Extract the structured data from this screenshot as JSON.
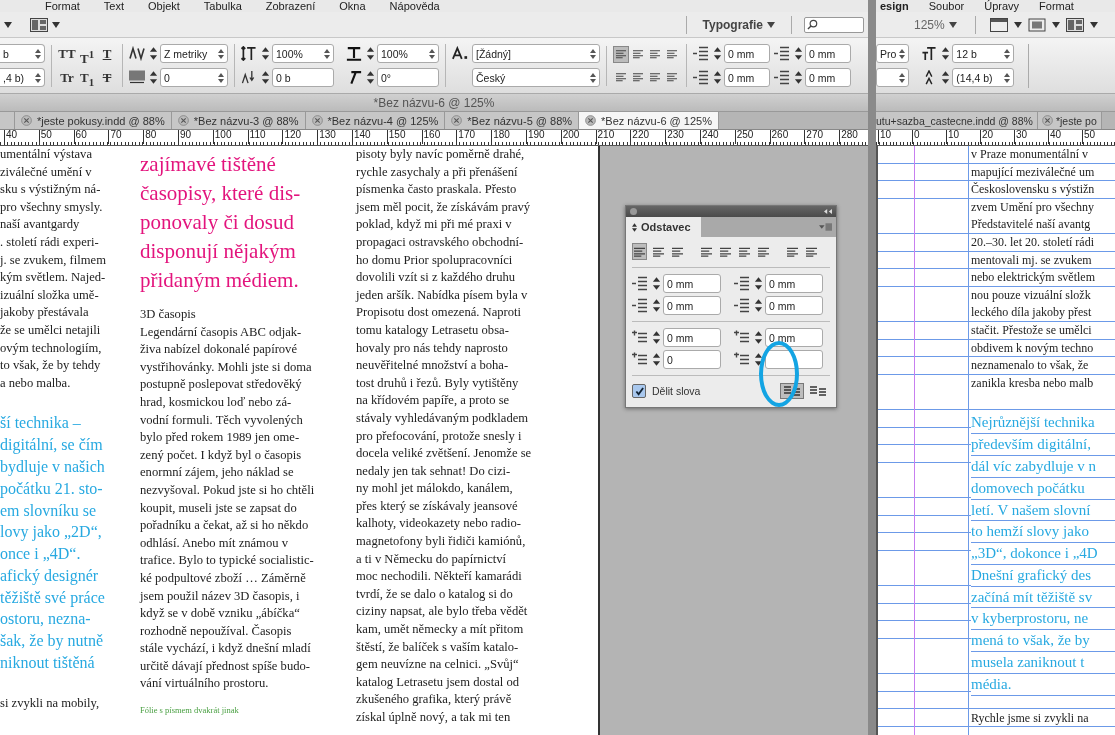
{
  "left_window": {
    "menu": [
      "Format",
      "Text",
      "Objekt",
      "Tabulka",
      "Zobrazení",
      "Okna",
      "Nápověda"
    ],
    "toolbar": {
      "workspace": "Typografie"
    },
    "control_panel": {
      "size_fields": [
        "b",
        ",4 b)"
      ],
      "type_buttons": [
        {
          "label": "TT",
          "kind": "plain"
        },
        {
          "label": "T$^{1}$",
          "kind": "plain"
        },
        {
          "label": "T",
          "kind": "underline"
        },
        {
          "label": "Tr",
          "kind": "plain"
        },
        {
          "label": "T$_{1}$",
          "kind": "plain"
        },
        {
          "label": "T",
          "kind": "strike"
        }
      ],
      "kerning": "Z metriky",
      "tracking": "0",
      "vertical_scale": "100%",
      "baseline_shift": "0 b",
      "horizontal_scale": "100%",
      "skew": "0°",
      "character_style": "[Žádný]",
      "language": "Český",
      "align_buttons": [
        {
          "selected": true
        },
        {
          "selected": false
        },
        {
          "selected": false
        },
        {
          "selected": false
        },
        {
          "selected": false
        },
        {
          "selected": false
        },
        {
          "selected": false
        },
        {
          "selected": false
        }
      ],
      "indents": [
        "0 mm",
        "0 mm",
        "0 mm",
        "0 mm"
      ]
    },
    "document_title": "*Bez názvu-6 @ 125%",
    "tabs": [
      {
        "label": "*jeste pokusy.indd @ 88%",
        "selected": false
      },
      {
        "label": "*Bez názvu-3 @ 88%",
        "selected": false
      },
      {
        "label": "*Bez názvu-4 @ 125%",
        "selected": false
      },
      {
        "label": "*Bez názvu-5 @ 88%",
        "selected": false
      },
      {
        "label": "*Bez názvu-6 @ 125%",
        "selected": true
      }
    ],
    "ruler": [
      "40",
      "50",
      "60",
      "70",
      "80",
      "90",
      "100",
      "110",
      "120",
      "130",
      "140",
      "150",
      "160",
      "170",
      "180",
      "190",
      "200",
      "210",
      "220",
      "230",
      "240",
      "250",
      "260",
      "270",
      "280"
    ],
    "page": {
      "column_1": {
        "body_lines": [
          "umentální výstava",
          "ziválečné umění v",
          "sku s výstižným ná-",
          "pro všechny smysly.",
          "naší avantgardy",
          ". století rádi experi-",
          "j. se zvukem, filmem",
          "kým světlem. Najed-",
          "izuální složka umě-",
          "jakoby přestávala",
          "že se umělci netajili",
          "ovým technologiím,",
          "to však, že by tehdy",
          "a nebo malba."
        ],
        "pull_quote_lines": [
          "ší technika –",
          "digitální, se čím",
          "bydluje v našich",
          "počátku 21. sto-",
          "em slovníku se",
          "lovy jako „2D“,",
          "once i „4D“.",
          "afický designér",
          "těžiště své práce",
          "ostoru, nezna-",
          "šak, že by nutně",
          "niknout tištěná"
        ],
        "tail_lines": [
          "si zvykli na mobily,"
        ]
      },
      "column_2": {
        "heading_lines": [
          "zajímavé tištěné",
          "časopisy, které dis-",
          "ponovaly či dosud",
          "disponují nějakým",
          "přidaným médiem."
        ],
        "subhead": "3D časopis",
        "body_lines": [
          "Legendární časopis ABC odjak-",
          "živa nabízel dokonalé papírové",
          "vystřihovánky. Mohli jste si doma",
          "postupně poslepovat středověký",
          "hrad, kosmickou loď nebo zá-",
          "vodní formuli. Těch vyvolených",
          "bylo před rokem 1989 jen ome-",
          "zený počet. I když byl o časopis",
          "enormní zájem, jeho náklad se",
          "nezvyšoval. Pokud jste si ho chtěli",
          "koupit, museli jste se zapsat do",
          "pořadníku a čekat, až si ho někdo",
          "odhlásí. Anebo mít známou v",
          "trafice. Bylo to typické socialistic-",
          "ké podpultové zboží … Záměrně",
          "jsem použil název 3D časopis, i",
          "když se v době vzniku „ábíčka“",
          "rozhodně nepoužíval. Časopis",
          "stále vychází, i když dnešní mladí",
          "určitě dávají přednost spíše budo-",
          "vání virtuálního prostoru."
        ],
        "caption": "Fólie s písmem dvakrát jinak"
      },
      "column_3": {
        "body_lines": [
          "pisoty byly navíc poměrně drahé,",
          "rychle zasychaly a při přenášení",
          "písmenka často praskala. Přesto",
          "jsem měl pocit, že získávám pravý",
          "poklad, když mi při mé praxi v",
          "propagaci ostravského obchodní-",
          "ho domu Prior spolupracovníci",
          "dovolili vzít si z každého druhu",
          "jeden aršík. Nabídka písem byla v",
          "Propisotu dost omezená. Naproti",
          "tomu katalogy Letrasetu obsa-",
          "hovaly pro nás tehdy naprosto",
          "neuvěřitelné množství a boha-",
          "tost druhů i řezů. Byly vytištěny",
          "na křídovém papíře, a proto se",
          "stávaly vyhledávaným podkladem",
          "pro přefocování, protože snesly i",
          "docela veliké zvětšení. Jenomže se",
          "nedaly jen tak sehnat! Do cizi-",
          "ny mohl jet málokdo, kanálem,",
          "přes který se získávaly jeansové",
          "kalhoty, videokazety nebo radio-",
          "magnetofony byli řidiči kamiónů,",
          "a ti v Německu do papírnictví",
          "moc nechodili. Někteří kamarádi",
          "tvrdí, že se dalo o katalog si do",
          "ciziny napsat, ale bylo třeba vědět",
          "kam, umět německy a mít přitom",
          "štěstí, že balíček s vaším katalo-",
          "gem neuvízne na celnici. „Svůj“",
          "katalog Letrasetu jsem dostal od",
          "zkušeného grafika, který právě",
          "získal úplně nový, a tak mi ten"
        ]
      }
    },
    "paragraph_panel": {
      "tab": "Odstavec",
      "align_buttons": [
        {
          "selected": true
        },
        {
          "selected": false
        },
        {
          "selected": false
        },
        {
          "selected": false
        },
        {
          "selected": false
        },
        {
          "selected": false
        },
        {
          "selected": false
        },
        {
          "selected": false
        },
        {
          "selected": false
        }
      ],
      "fields": [
        "0 mm",
        "0 mm",
        "0 mm",
        "0 mm",
        "0 mm",
        "0 mm",
        "0"
      ],
      "hyphenate": {
        "label": "Dělit slova",
        "checked": true
      },
      "layout_buttons": [
        {
          "selected": true
        },
        {
          "selected": false
        }
      ]
    }
  },
  "right_window": {
    "menu": [
      "esign",
      "Soubor",
      "Úpravy",
      "Format"
    ],
    "toolbar": {
      "zoom": "125%"
    },
    "control_panel": {
      "font": "Pro",
      "size": "12 b",
      "leading": "(14,4 b)"
    },
    "tabs": [
      {
        "label": "utu+sazba_castecne.indd @ 88%",
        "selected": false
      },
      {
        "label": "*jeste po",
        "selected": false
      }
    ],
    "ruler": [
      "10",
      "0",
      "10",
      "20",
      "30",
      "40",
      "50"
    ],
    "page": {
      "body_lines": [
        "v Praze monumentální v",
        "mapující meziválečné um",
        "Československu s výstižn",
        "zvem Umění pro všechny",
        "Představitelé naší avantg",
        "20.–30. let 20. století rádi",
        "mentovali mj. se zvukem",
        "nebo elektrickým světlem",
        "nou pouze vizuální složk",
        "leckého díla jakoby přest",
        "stačit. Přestože se umělci",
        "obdivem k novým techno",
        "neznamenalo to však, že",
        "zanikla kresba nebo malb"
      ],
      "pull_quote_lines": [
        "Nejrůznější technika",
        "především digitální,",
        "dál víc zabydluje v n",
        "domovech počátku",
        "letí. V našem slovní",
        "to hemží slovy jako",
        "„3D“, dokonce i „4D",
        "Dnešní grafický des",
        "začíná mít těžiště sv",
        "v kyberprostoru, ne",
        "mená to však, že by",
        "musela zaniknout t",
        "média."
      ],
      "tail_lines": [
        "Rychle jsme si zvykli na"
      ]
    }
  }
}
